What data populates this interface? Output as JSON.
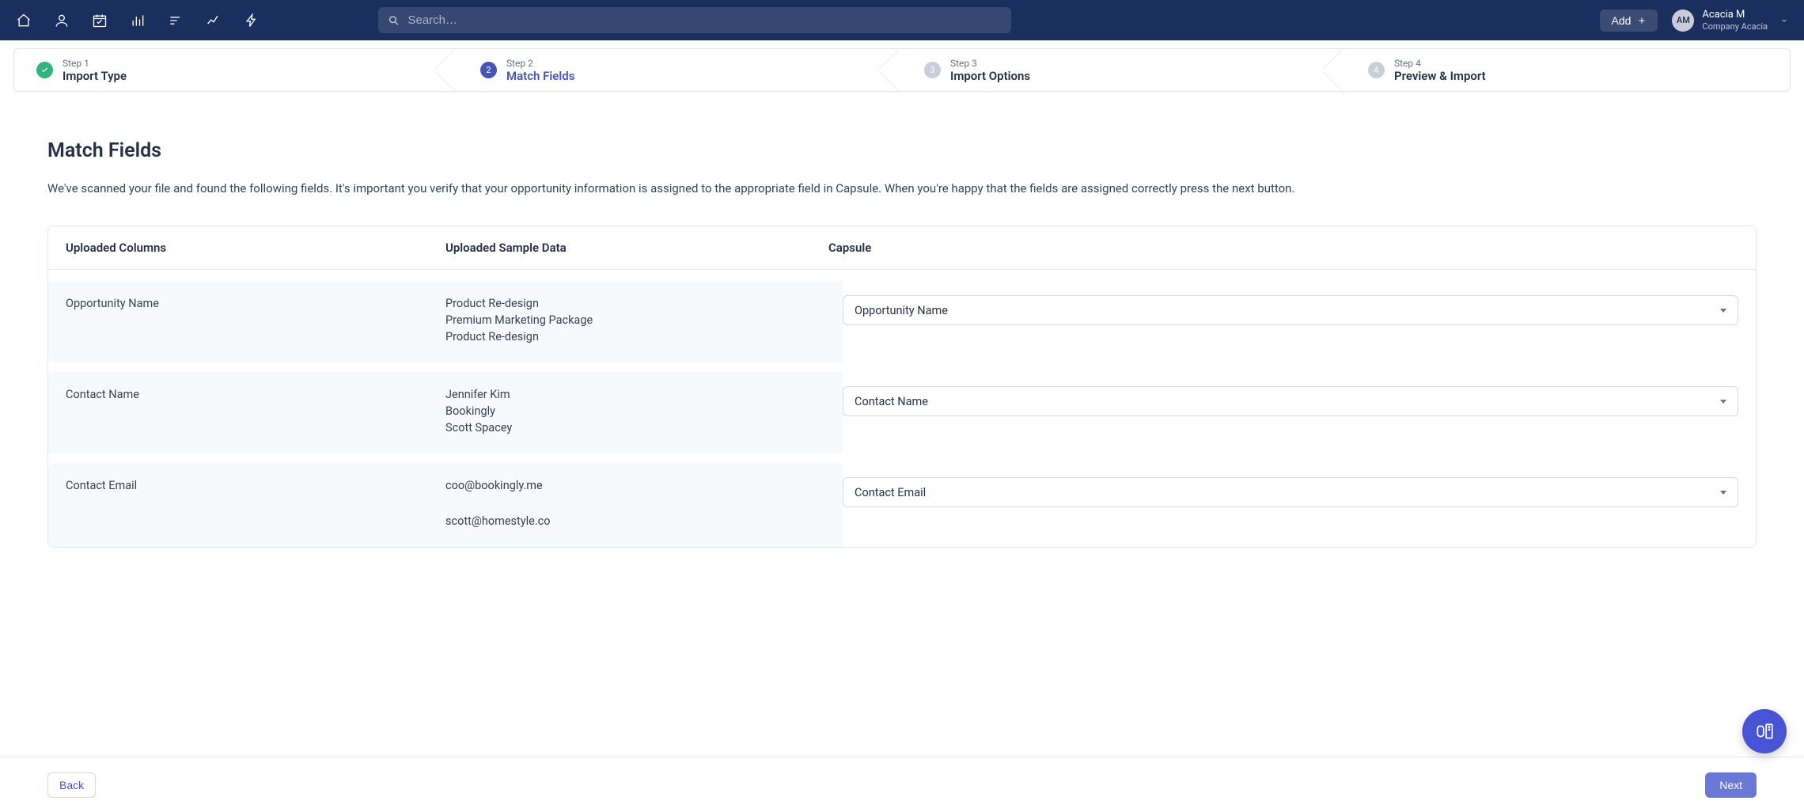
{
  "topbar": {
    "search_placeholder": "Search…",
    "add_label": "Add",
    "user": {
      "initials": "AM",
      "name": "Acacia M",
      "org": "Company Acacia"
    }
  },
  "stepper": {
    "steps": [
      {
        "status": "complete",
        "label": "Step 1",
        "title": "Import Type",
        "number": "1"
      },
      {
        "status": "active",
        "label": "Step 2",
        "title": "Match Fields",
        "number": "2"
      },
      {
        "status": "pending",
        "label": "Step 3",
        "title": "Import Options",
        "number": "3"
      },
      {
        "status": "pending",
        "label": "Step 4",
        "title": "Preview & Import",
        "number": "4"
      }
    ]
  },
  "page": {
    "title": "Match Fields",
    "description": "We've scanned your file and found the following fields. It's important you verify that your opportunity information is assigned to the appropriate field in Capsule. When you're happy that the fields are assigned correctly press the next button."
  },
  "table": {
    "headers": {
      "uploaded_columns": "Uploaded Columns",
      "uploaded_sample": "Uploaded Sample Data",
      "capsule": "Capsule"
    },
    "rows": [
      {
        "uploaded_column": "Opportunity Name",
        "samples": [
          "Product Re-design",
          "Premium Marketing Package",
          "Product Re-design"
        ],
        "capsule_selected": "Opportunity Name"
      },
      {
        "uploaded_column": "Contact Name",
        "samples": [
          "Jennifer Kim",
          "Bookingly",
          "Scott Spacey"
        ],
        "capsule_selected": "Contact Name"
      },
      {
        "uploaded_column": "Contact Email",
        "samples": [
          "coo@bookingly.me",
          "scott@homestyle.co"
        ],
        "capsule_selected": "Contact Email"
      }
    ]
  },
  "footer": {
    "back": "Back",
    "next": "Next"
  }
}
